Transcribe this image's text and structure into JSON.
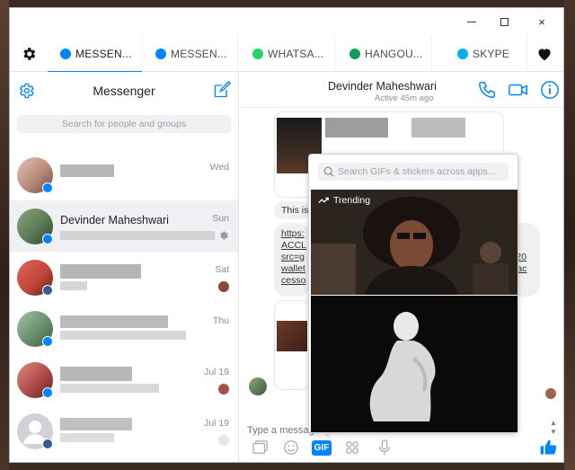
{
  "window": {
    "controls": {
      "minimize": "minimize",
      "maximize": "maximize",
      "close": "×"
    }
  },
  "tabs": [
    {
      "label": "MESSEN...",
      "icon": "messenger-icon",
      "active": true
    },
    {
      "label": "MESSEN...",
      "icon": "messenger-icon",
      "active": false
    },
    {
      "label": "WHATSA...",
      "icon": "whatsapp-icon",
      "active": false
    },
    {
      "label": "HANGOU...",
      "icon": "hangouts-icon",
      "active": false
    },
    {
      "label": "SKYPE",
      "icon": "skype-icon",
      "active": false
    }
  ],
  "sidebar": {
    "title": "Messenger",
    "search_placeholder": "Search for people and groups",
    "conversations": [
      {
        "name": "",
        "date": "Wed",
        "avatar_color": "#b98a7a",
        "badge": "messenger"
      },
      {
        "name": "Devinder Maheshwari",
        "date": "Sun",
        "avatar_color": "#5a7a55",
        "badge": "messenger",
        "selected": true
      },
      {
        "name": "",
        "date": "Sat",
        "avatar_color": "#c2483a",
        "badge": "facebook"
      },
      {
        "name": "",
        "date": "Thu",
        "avatar_color": "#6a8f6e",
        "badge": "messenger"
      },
      {
        "name": "",
        "date": "Jul 19",
        "avatar_color": "#b04a4a",
        "badge": "messenger"
      },
      {
        "name": "",
        "date": "Jul 19",
        "avatar_color": "#d0d2d6",
        "badge": "facebook"
      }
    ]
  },
  "conversation": {
    "name": "Devinder Maheshwari",
    "status": "Active 45m ago",
    "messages": {
      "text_fragment": "This is",
      "link_lines": [
        "https:",
        "ACCL",
        "src=g",
        "wallet",
        "cesso"
      ],
      "link_right": [
        "t-",
        "s20",
        "Fac"
      ]
    },
    "composer_placeholder": "Type a message..."
  },
  "gif_picker": {
    "search_placeholder": "Search GIFs & stickers across apps...",
    "section_label": "Trending",
    "gif_button_label": "GIF"
  },
  "colors": {
    "accent": "#0084ff",
    "whatsapp": "#25d366",
    "hangouts": "#0f9d58",
    "skype": "#00aff0"
  }
}
